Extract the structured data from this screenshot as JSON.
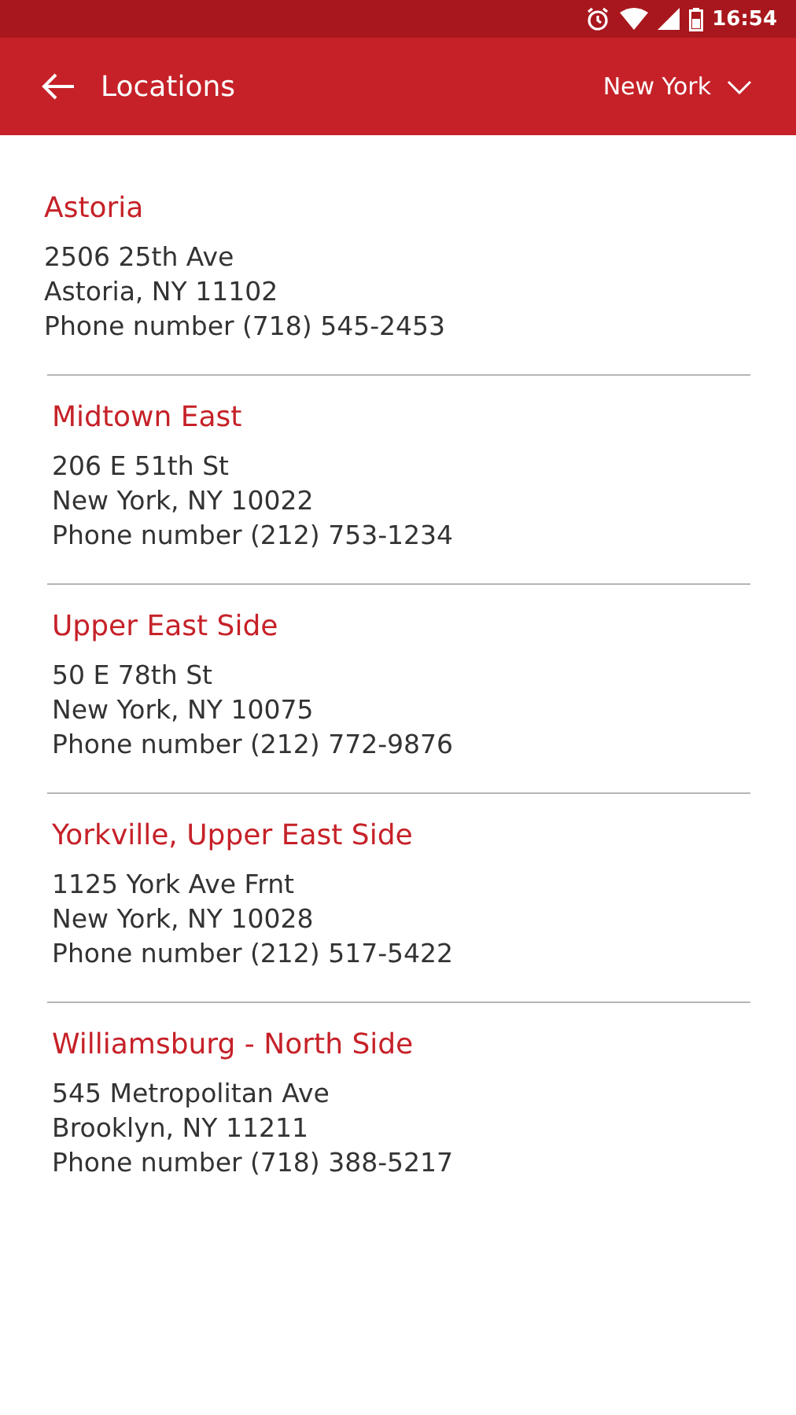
{
  "status_bar": {
    "time": "16:54"
  },
  "toolbar": {
    "title": "Locations",
    "city": "New York"
  },
  "locations": [
    {
      "name": "Astoria",
      "lines": [
        "2506 25th Ave",
        "Astoria, NY 11102",
        "Phone number (718) 545-2453"
      ]
    },
    {
      "name": "Midtown East",
      "lines": [
        "206 E 51th St",
        "New York, NY 10022",
        "Phone number (212) 753-1234"
      ]
    },
    {
      "name": "Upper East Side",
      "lines": [
        "50 E 78th St",
        "New York, NY 10075",
        "Phone number (212) 772-9876"
      ]
    },
    {
      "name": "Yorkville, Upper East Side",
      "lines": [
        "1125 York Ave Frnt",
        "New York, NY 10028",
        "Phone number (212) 517-5422"
      ]
    },
    {
      "name": "Williamsburg - North Side",
      "lines": [
        "545 Metropolitan Ave",
        "Brooklyn, NY 11211",
        "Phone number (718) 388-5217"
      ]
    }
  ]
}
